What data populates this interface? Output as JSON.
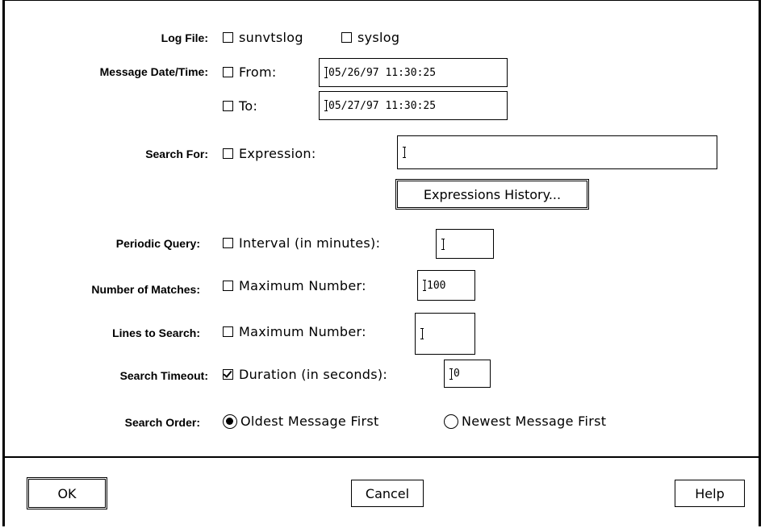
{
  "form": {
    "log_file": {
      "label": "Log File:",
      "options": [
        {
          "text": "sunvtslog",
          "checked": false
        },
        {
          "text": "syslog",
          "checked": false
        }
      ]
    },
    "message_datetime": {
      "label": "Message Date/Time:",
      "from_label": "From:",
      "from_checked": false,
      "from_value": "05/26/97 11:30:25",
      "to_label": "To:",
      "to_checked": false,
      "to_value": "05/27/97 11:30:25"
    },
    "search_for": {
      "label": "Search For:",
      "option": "Expression:",
      "checked": false,
      "value": "",
      "history_button": "Expressions History..."
    },
    "periodic_query": {
      "label": "Periodic Query:",
      "option": "Interval (in minutes):",
      "checked": false,
      "value": ""
    },
    "number_of_matches": {
      "label": "Number of Matches:",
      "option": "Maximum Number:",
      "checked": false,
      "value": "100"
    },
    "lines_to_search": {
      "label": "Lines to Search:",
      "option": "Maximum Number:",
      "checked": false,
      "value": ""
    },
    "search_timeout": {
      "label": "Search Timeout:",
      "option": "Duration (in seconds):",
      "checked": true,
      "value": "0"
    },
    "search_order": {
      "label": "Search Order:",
      "options": [
        {
          "text": "Oldest Message First",
          "selected": true
        },
        {
          "text": "Newest Message First",
          "selected": false
        }
      ]
    }
  },
  "buttons": {
    "ok": "OK",
    "cancel": "Cancel",
    "help": "Help"
  }
}
